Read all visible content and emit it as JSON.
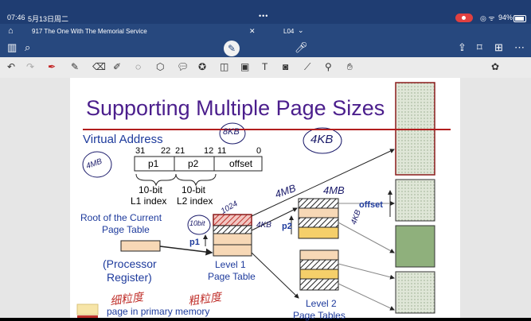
{
  "status_bar": {
    "time": "07:46",
    "date": "5月13日周二",
    "dots": "•••",
    "wifi": "⌔",
    "battery": "94%"
  },
  "tabs": {
    "tab1": "917 The One With The Memorial Service",
    "tab2": "L04"
  },
  "slide": {
    "title": "Supporting Multiple Page Sizes",
    "virtual_address": "Virtual Address",
    "bits": [
      "31",
      "22",
      "21",
      "12",
      "11",
      "0"
    ],
    "fields": [
      "p1",
      "p2",
      "offset"
    ],
    "l1_label": [
      "10-bit",
      "L1 index"
    ],
    "l2_label": [
      "10-bit",
      "L2 index"
    ],
    "root_label": [
      "Root of the Current",
      "Page Table"
    ],
    "processor_label": [
      "(Processor",
      "Register)"
    ],
    "level1_label": [
      "Level 1",
      "Page Table"
    ],
    "level2_label": [
      "Level 2",
      "Page Tables"
    ],
    "p1": "p1",
    "p2": "p2",
    "offset": "offset",
    "legend": "page in primary memory"
  },
  "annotations": {
    "h8kb": "8KB",
    "h4kb": "4KB",
    "h4mb1": "4MB",
    "h4mb2": "4MB",
    "h1024": "1024",
    "h4kb_small": "4KB",
    "hnum1": "10bit",
    "h4kb2": "4KB",
    "hside": "4MB",
    "cn1": "细粒度",
    "cn2": "粗粒度"
  },
  "colors": {
    "bar": "#1f3d72",
    "title": "#4b1e8c",
    "blue_text": "#1d3a9c",
    "red": "#b21d1d",
    "page_green": "#8fb07c",
    "hatch_pink": "#f2c7c2"
  }
}
